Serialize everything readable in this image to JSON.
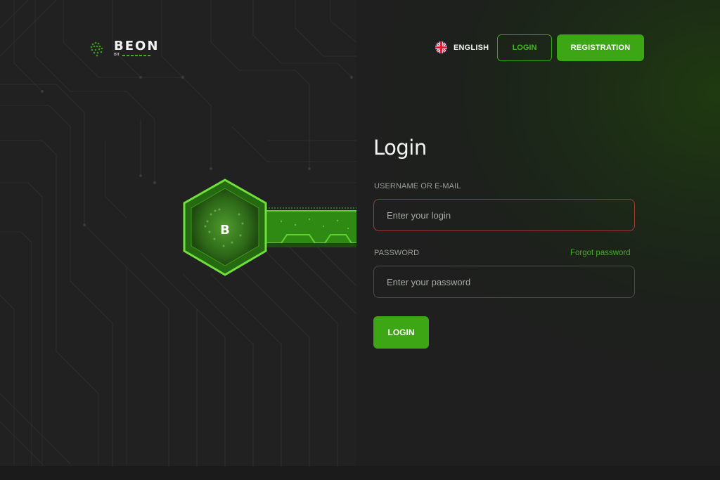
{
  "header": {
    "logo": {
      "word": "BEON",
      "sub": "BIT",
      "icon": "globe-icon"
    },
    "language": {
      "label": "ENGLISH",
      "icon": "uk-flag-icon"
    },
    "login_label": "LOGIN",
    "register_label": "REGISTRATION"
  },
  "hero": {
    "badge_letter": "B",
    "icon": "hexagon-key-icon"
  },
  "form": {
    "title": "Login",
    "username": {
      "label": "USERNAME OR E-MAIL",
      "placeholder": "Enter your login",
      "value": ""
    },
    "password": {
      "label": "PASSWORD",
      "placeholder": "Enter your password",
      "value": ""
    },
    "forgot_label": "Forgot password",
    "submit_label": "LOGIN"
  },
  "colors": {
    "accent": "#3ca614",
    "accent_text": "#3fae1f",
    "error_border": "#a13b38",
    "background": "#1e1f1e"
  }
}
